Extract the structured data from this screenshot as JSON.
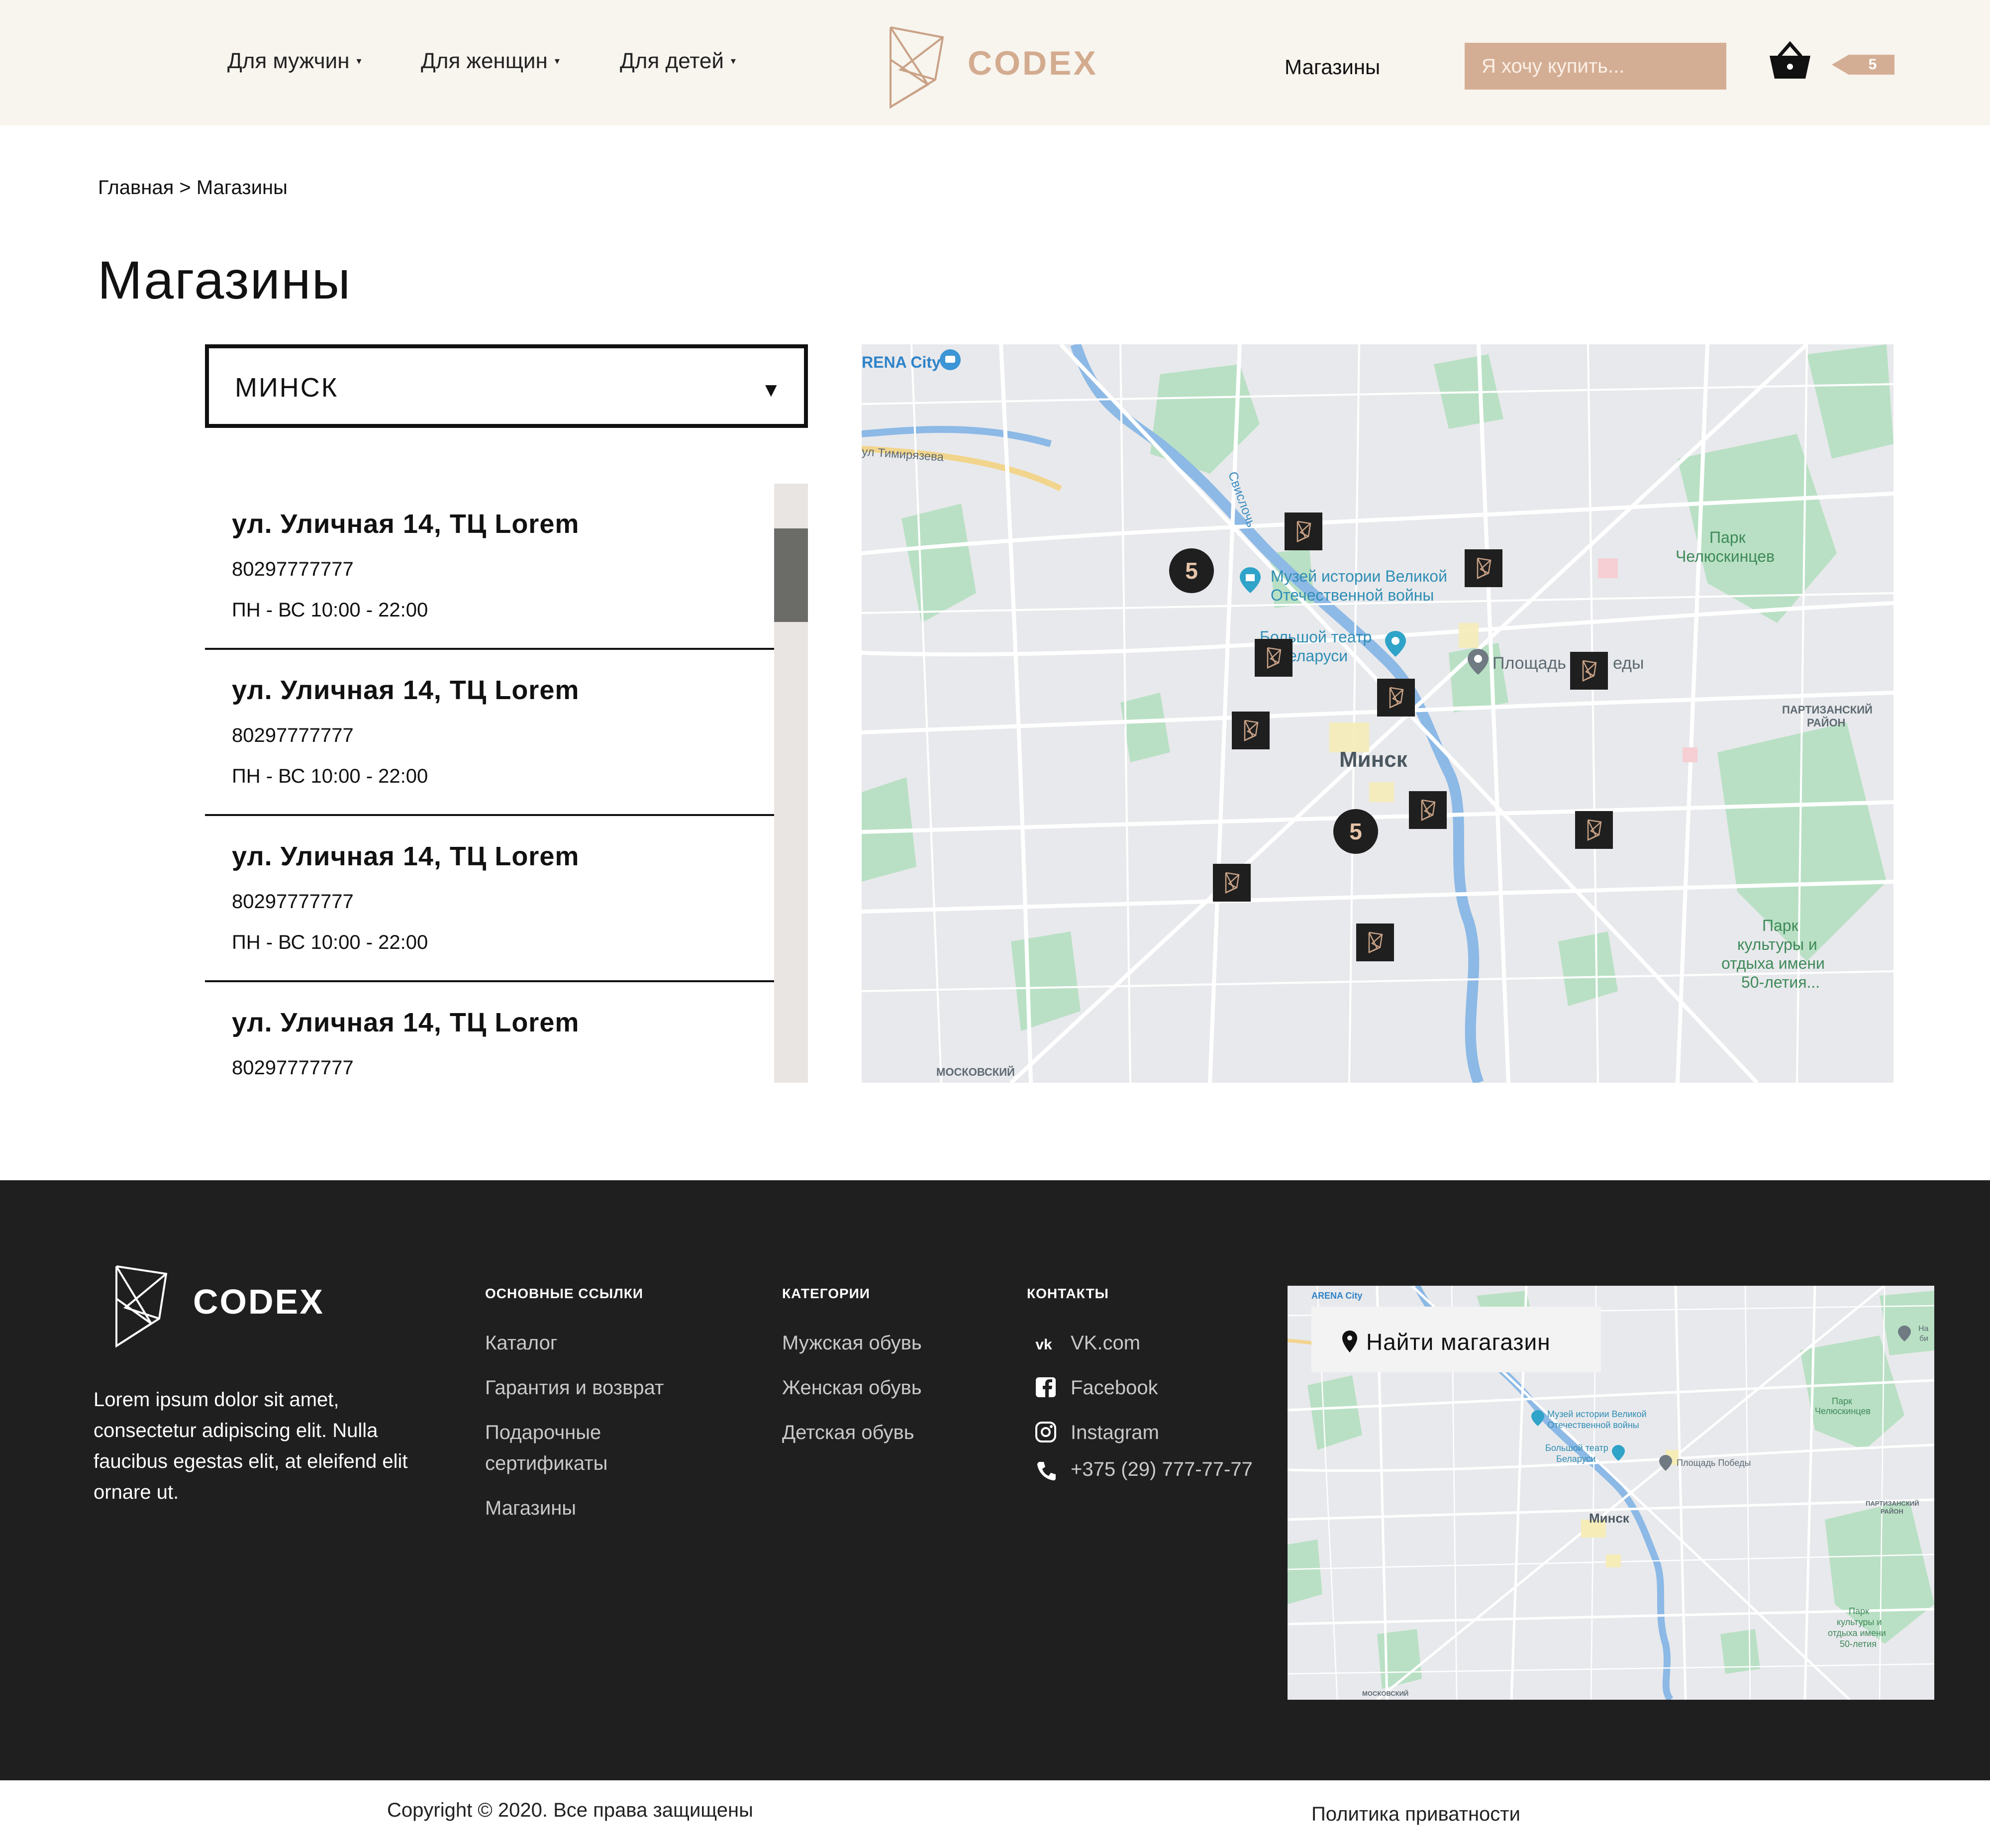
{
  "header": {
    "nav": [
      {
        "label": "Для мужчин"
      },
      {
        "label": "Для женщин"
      },
      {
        "label": "Для детей"
      }
    ],
    "caret": "▾",
    "logo_text": "CODEX",
    "stores_link": "Магазины",
    "search_placeholder": "Я хочу купить...",
    "cart_count": "5",
    "colors": {
      "bg": "#f8f4ee",
      "accent": "#d4ae94"
    }
  },
  "breadcrumb": "Главная > Магазины",
  "page_title": "Магазины",
  "city_select": {
    "value": "МИНСК",
    "arrow": "▼"
  },
  "stores": [
    {
      "name": "ул. Уличная 14, ТЦ Lorem",
      "phone": "80297777777",
      "hours": "ПН - ВС 10:00 - 22:00"
    },
    {
      "name": "ул. Уличная 14, ТЦ Lorem",
      "phone": "80297777777",
      "hours": "ПН - ВС 10:00 - 22:00"
    },
    {
      "name": "ул. Уличная 14, ТЦ Lorem",
      "phone": "80297777777",
      "hours": "ПН - ВС 10:00 - 22:00"
    },
    {
      "name": "ул. Уличная 14, ТЦ Lorem",
      "phone": "80297777777",
      "hours": ""
    }
  ],
  "map": {
    "labels": {
      "arena": "RENA City",
      "timiryazeva": "ул Тимирязева",
      "svisloch": "Свислочь",
      "museum_1": "Музей истории Великой",
      "museum_2": "Отечественной войны",
      "theatre_1": "Большой театр",
      "theatre_2": "Беларуси",
      "square_a": "Площадь",
      "square_b": "еды",
      "park1_1": "Парк",
      "park1_2": "Челюскинцев",
      "district_1": "ПАРТИЗАНСКИЙ",
      "district_2": "РАЙОН",
      "city": "Минск",
      "park2_1": "Парк",
      "park2_2": "культуры и",
      "park2_3": "отдыха имени",
      "park2_4": "50-летия...",
      "moskovsky": "МОСКОВСКИЙ"
    },
    "clusters": [
      "5",
      "5"
    ]
  },
  "footer": {
    "logo_text": "CODEX",
    "about": "Lorem ipsum dolor sit amet, consectetur adipiscing elit. Nulla faucibus egestas elit, at eleifend elit ornare ut.",
    "col1": {
      "heading": "ОСНОВНЫЕ ССЫЛКИ",
      "links": [
        "Каталог",
        "Гарантия и возврат",
        "Подарочные сертификаты",
        "Магазины"
      ]
    },
    "col2": {
      "heading": "КАТЕГОРИИ",
      "links": [
        "Мужская обувь",
        "Женская обувь",
        "Детская обувь"
      ]
    },
    "col3": {
      "heading": "КОНТАКТЫ",
      "links": [
        "VK.com",
        "Facebook",
        "Instagram",
        "+375 (29) 777-77-77"
      ]
    },
    "find_store": "Найти магагазин",
    "map_labels": {
      "arena": "ARENA City",
      "museum_1": "Музей истории Великой",
      "museum_2": "Отечественной войны",
      "theatre_1": "Большой театр",
      "theatre_2": "Беларуси",
      "square": "Площадь Победы",
      "park1_1": "Парк",
      "park1_2": "Челюскинцев",
      "district_1": "ПАРТИЗАНСКИЙ",
      "district_2": "РАЙОН",
      "city": "Минск",
      "park2_1": "Парк",
      "park2_2": "культуры и",
      "park2_3": "отдыха имени",
      "park2_4": "50-летия",
      "moskovsky": "МОСКОВСКИЙ",
      "edge_a": "На",
      "edge_b": "би"
    },
    "copyright": "Copyright © 2020. Все права защищены",
    "privacy": "Политика приватности"
  }
}
